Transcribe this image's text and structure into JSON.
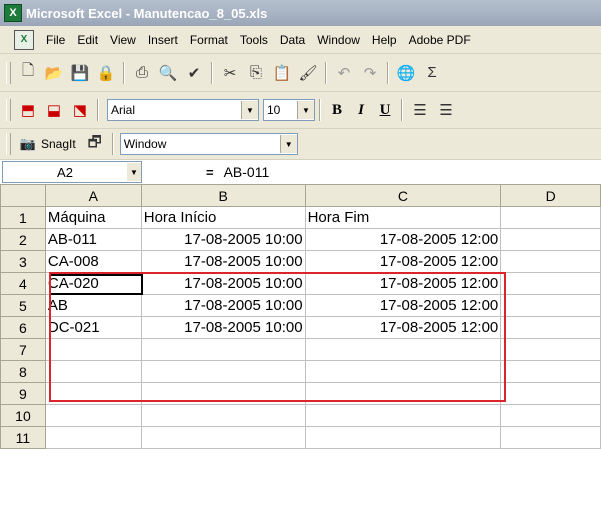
{
  "window": {
    "title": "Microsoft Excel - Manutencao_8_05.xls"
  },
  "menu": [
    "File",
    "Edit",
    "View",
    "Insert",
    "Format",
    "Tools",
    "Data",
    "Window",
    "Help",
    "Adobe PDF"
  ],
  "toolbar": {
    "font": "Arial",
    "size": "10",
    "bold": "B",
    "italic": "I",
    "underline": "U",
    "snagit": "SnagIt",
    "window_combo": "Window"
  },
  "formula": {
    "namebox": "A2",
    "equals": "=",
    "value": "AB-011"
  },
  "columns": [
    "A",
    "B",
    "C",
    "D"
  ],
  "rows": [
    {
      "n": "1",
      "a": "Máquina",
      "b": "Hora Início",
      "c": "Hora Fim",
      "d": ""
    },
    {
      "n": "2",
      "a": "AB-011",
      "b": "17-08-2005 10:00",
      "c": "17-08-2005 12:00",
      "d": ""
    },
    {
      "n": "3",
      "a": "CA-008",
      "b": "17-08-2005 10:00",
      "c": "17-08-2005 12:00",
      "d": ""
    },
    {
      "n": "4",
      "a": "CA-020",
      "b": "17-08-2005 10:00",
      "c": "17-08-2005 12:00",
      "d": ""
    },
    {
      "n": "5",
      "a": "AB",
      "b": "17-08-2005 10:00",
      "c": "17-08-2005 12:00",
      "d": ""
    },
    {
      "n": "6",
      "a": "DC-021",
      "b": "17-08-2005 10:00",
      "c": "17-08-2005 12:00",
      "d": ""
    },
    {
      "n": "7",
      "a": "",
      "b": "",
      "c": "",
      "d": ""
    },
    {
      "n": "8",
      "a": "",
      "b": "",
      "c": "",
      "d": ""
    },
    {
      "n": "9",
      "a": "",
      "b": "",
      "c": "",
      "d": ""
    },
    {
      "n": "10",
      "a": "",
      "b": "",
      "c": "",
      "d": ""
    },
    {
      "n": "11",
      "a": "",
      "b": "",
      "c": "",
      "d": ""
    }
  ],
  "colors": {
    "highlight": "#d9252b"
  }
}
